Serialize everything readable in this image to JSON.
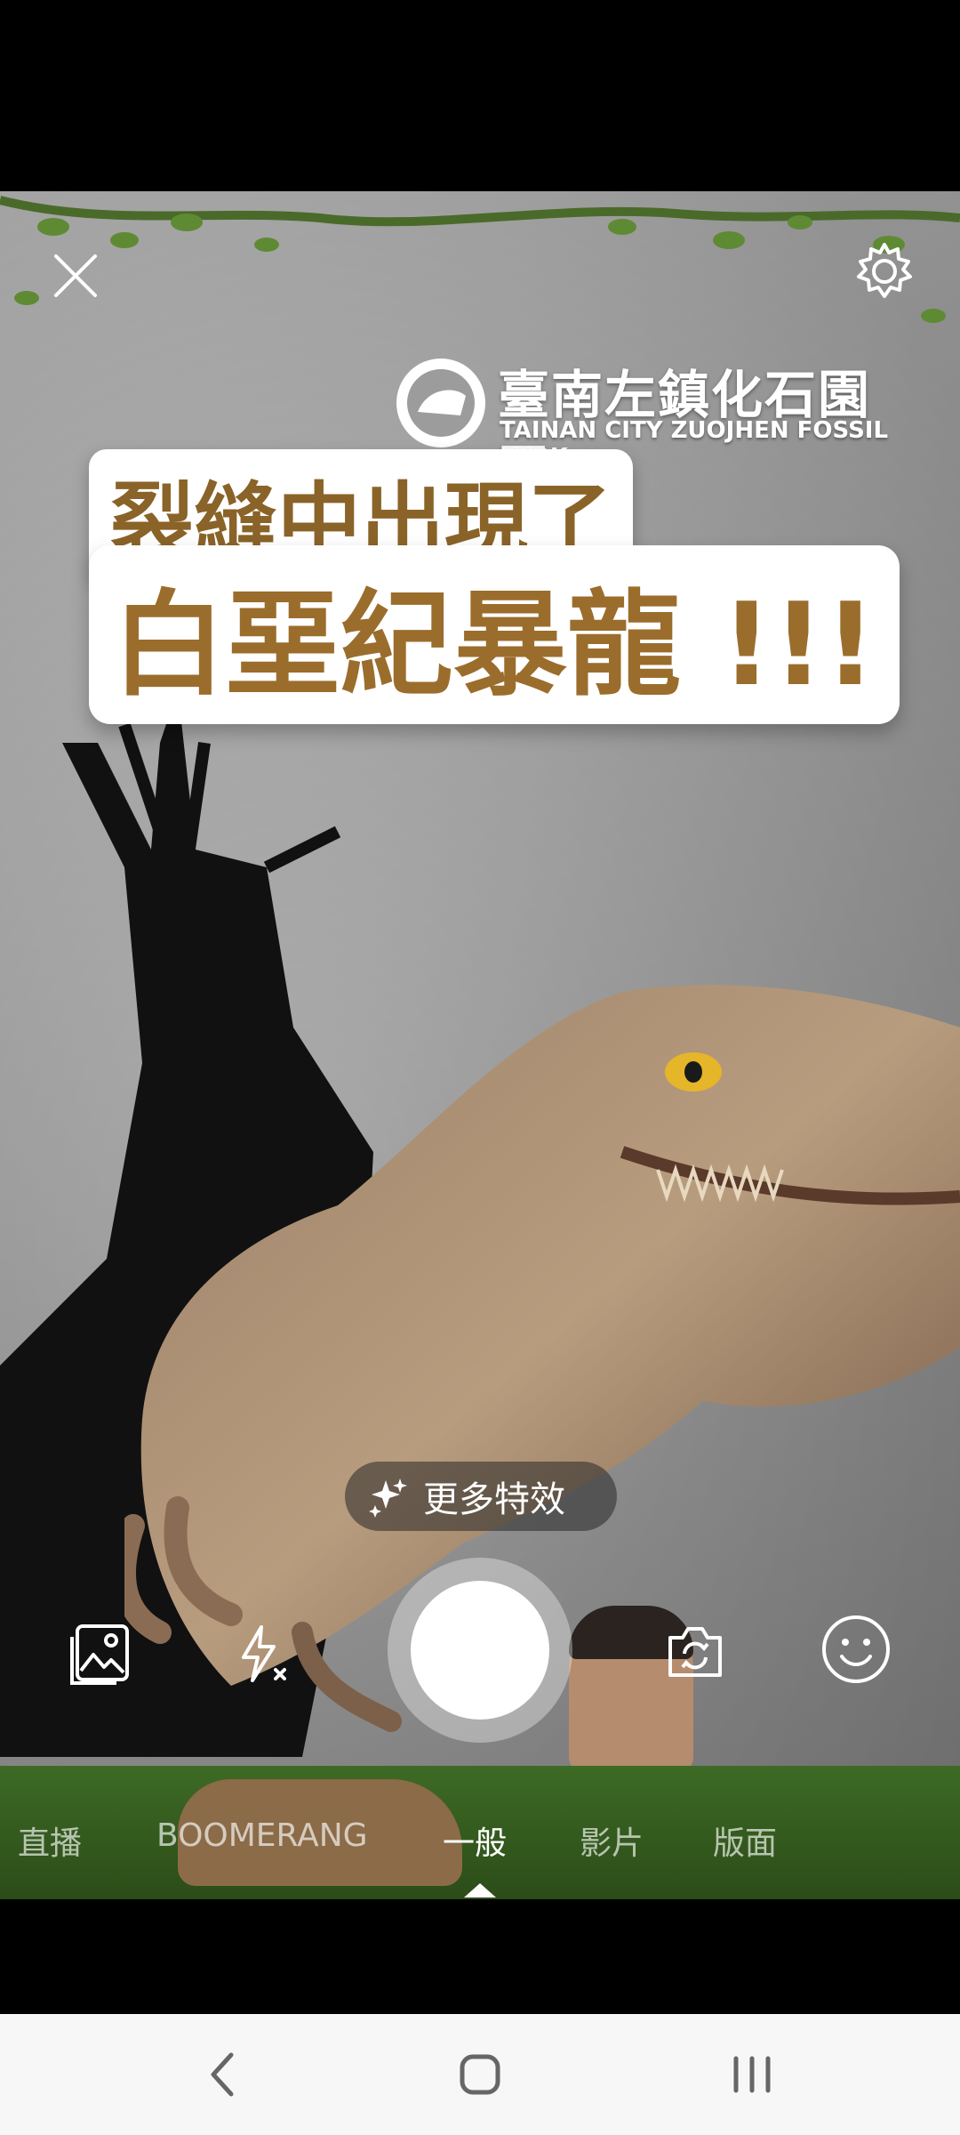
{
  "ar_title": {
    "logo_chinese": "臺南左鎮化石園區",
    "logo_english": "TAINAN CITY ZUOJHEN FOSSIL PARK",
    "line1": "裂縫中出現了",
    "line2": "白堊紀暴龍 !!!"
  },
  "controls": {
    "close_icon": "close-icon",
    "settings_icon": "gear-icon",
    "more_effects_label": "更多特效",
    "gallery_icon": "gallery-icon",
    "flash_icon": "flash-off-icon",
    "switch_camera_icon": "switch-camera-icon",
    "emoji_icon": "smiley-icon"
  },
  "modes": [
    "直播",
    "BOOMERANG",
    "一般",
    "影片",
    "版面"
  ],
  "active_mode": "一般",
  "nav": {
    "back_icon": "back-icon",
    "home_icon": "home-icon",
    "recents_icon": "recents-icon"
  },
  "colors": {
    "headline_brown": "#9b6d2c",
    "background": "#000000",
    "navbar": "#f7f7f7"
  }
}
